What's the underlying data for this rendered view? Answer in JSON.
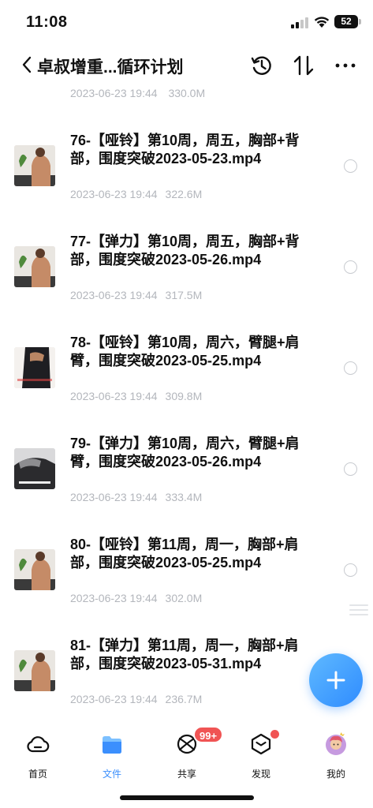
{
  "status_bar": {
    "time": "11:08",
    "battery": "52"
  },
  "header": {
    "title": "卓叔增重...循环计划"
  },
  "top_meta": {
    "date": "2023-06-23 19:44",
    "size": "330.0M"
  },
  "files": [
    {
      "title": "76-【哑铃】第10周，周五，胸部+背部，围度突破2023-05-23.mp4",
      "date": "2023-06-23 19:44",
      "size": "322.6M",
      "thumb": "back-thumb"
    },
    {
      "title": "77-【弹力】第10周，周五，胸部+背部，围度突破2023-05-26.mp4",
      "date": "2023-06-23 19:44",
      "size": "317.5M",
      "thumb": "back-thumb"
    },
    {
      "title": "78-【哑铃】第10周，周六，臂腿+肩臂，围度突破2023-05-25.mp4",
      "date": "2023-06-23 19:44",
      "size": "309.8M",
      "thumb": "dark-thumb"
    },
    {
      "title": "79-【弹力】第10周，周六，臂腿+肩臂，围度突破2023-05-26.mp4",
      "date": "2023-06-23 19:44",
      "size": "333.4M",
      "thumb": "gray-thumb"
    },
    {
      "title": "80-【哑铃】第11周，周一，胸部+肩部，围度突破2023-05-25.mp4",
      "date": "2023-06-23 19:44",
      "size": "302.0M",
      "thumb": "back-thumb"
    },
    {
      "title": "81-【弹力】第11周，周一，胸部+肩部，围度突破2023-05-31.mp4",
      "date": "2023-06-23 19:44",
      "size": "236.7M",
      "thumb": "back-thumb"
    }
  ],
  "tabbar": {
    "items": [
      {
        "label": "首页",
        "icon": "cloud-icon"
      },
      {
        "label": "文件",
        "icon": "folder-icon"
      },
      {
        "label": "共享",
        "icon": "share-icon"
      },
      {
        "label": "发现",
        "icon": "discover-icon"
      },
      {
        "label": "我的",
        "icon": "avatar-icon"
      }
    ],
    "share_badge": "99+"
  },
  "colors": {
    "accent": "#3b8ffd",
    "badge": "#f05454",
    "meta_text": "#b3b6bc"
  }
}
